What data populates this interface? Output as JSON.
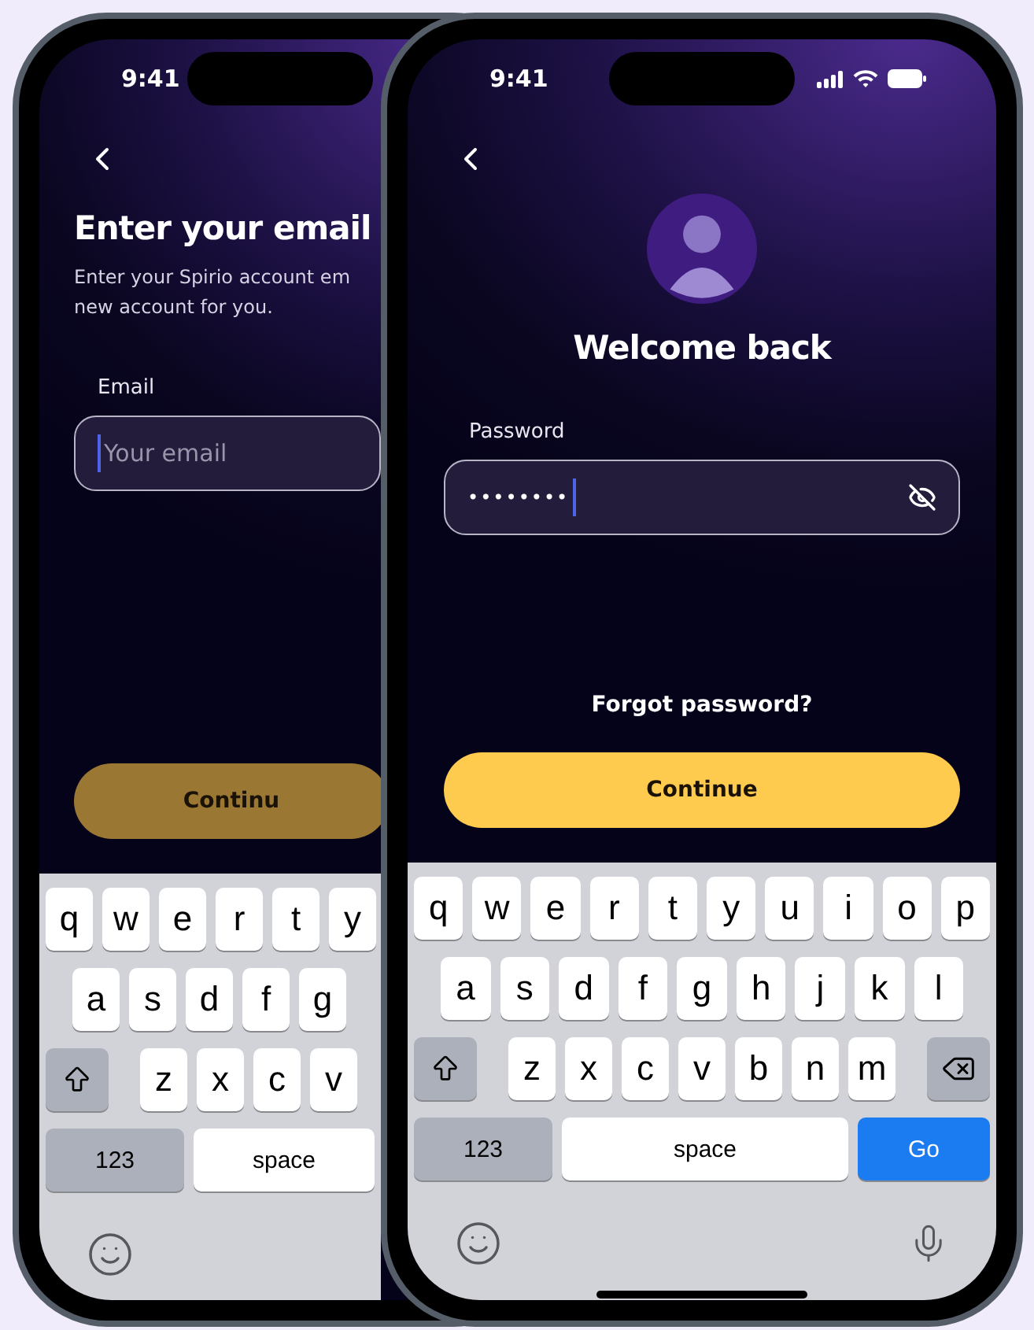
{
  "phones": [
    {
      "kind": "email",
      "time": "9:41",
      "status_icons": false,
      "title": "Enter your email",
      "subtitle_lines": [
        "Enter your Spirio account em",
        "new account for you."
      ],
      "field": {
        "label": "Email",
        "placeholder": "Your email",
        "focused": true
      },
      "button": {
        "label": "Continu",
        "disabled": true
      },
      "keyboard": {
        "rows": [
          [
            "q",
            "w",
            "e",
            "r",
            "t",
            "y"
          ],
          [
            "a",
            "s",
            "d",
            "f",
            "g"
          ],
          [
            "z",
            "x",
            "c",
            "v"
          ]
        ],
        "numbers_key": "123",
        "space_key": "space",
        "backspace": false,
        "mic": false
      }
    },
    {
      "kind": "password",
      "time": "9:41",
      "status_icons": true,
      "title": "Welcome back",
      "field": {
        "label": "Password",
        "value": "••••••••",
        "focused": true
      },
      "link": "Forgot password?",
      "button": {
        "label": "Continue",
        "disabled": false
      },
      "keyboard": {
        "rows": [
          [
            "q",
            "w",
            "e",
            "r",
            "t",
            "y",
            "u",
            "i",
            "o",
            "p"
          ],
          [
            "a",
            "s",
            "d",
            "f",
            "g",
            "h",
            "j",
            "k",
            "l"
          ],
          [
            "z",
            "x",
            "c",
            "v",
            "b",
            "n",
            "m"
          ]
        ],
        "numbers_key": "123",
        "space_key": "space",
        "go_key": "Go",
        "backspace": true,
        "mic": true
      }
    }
  ]
}
